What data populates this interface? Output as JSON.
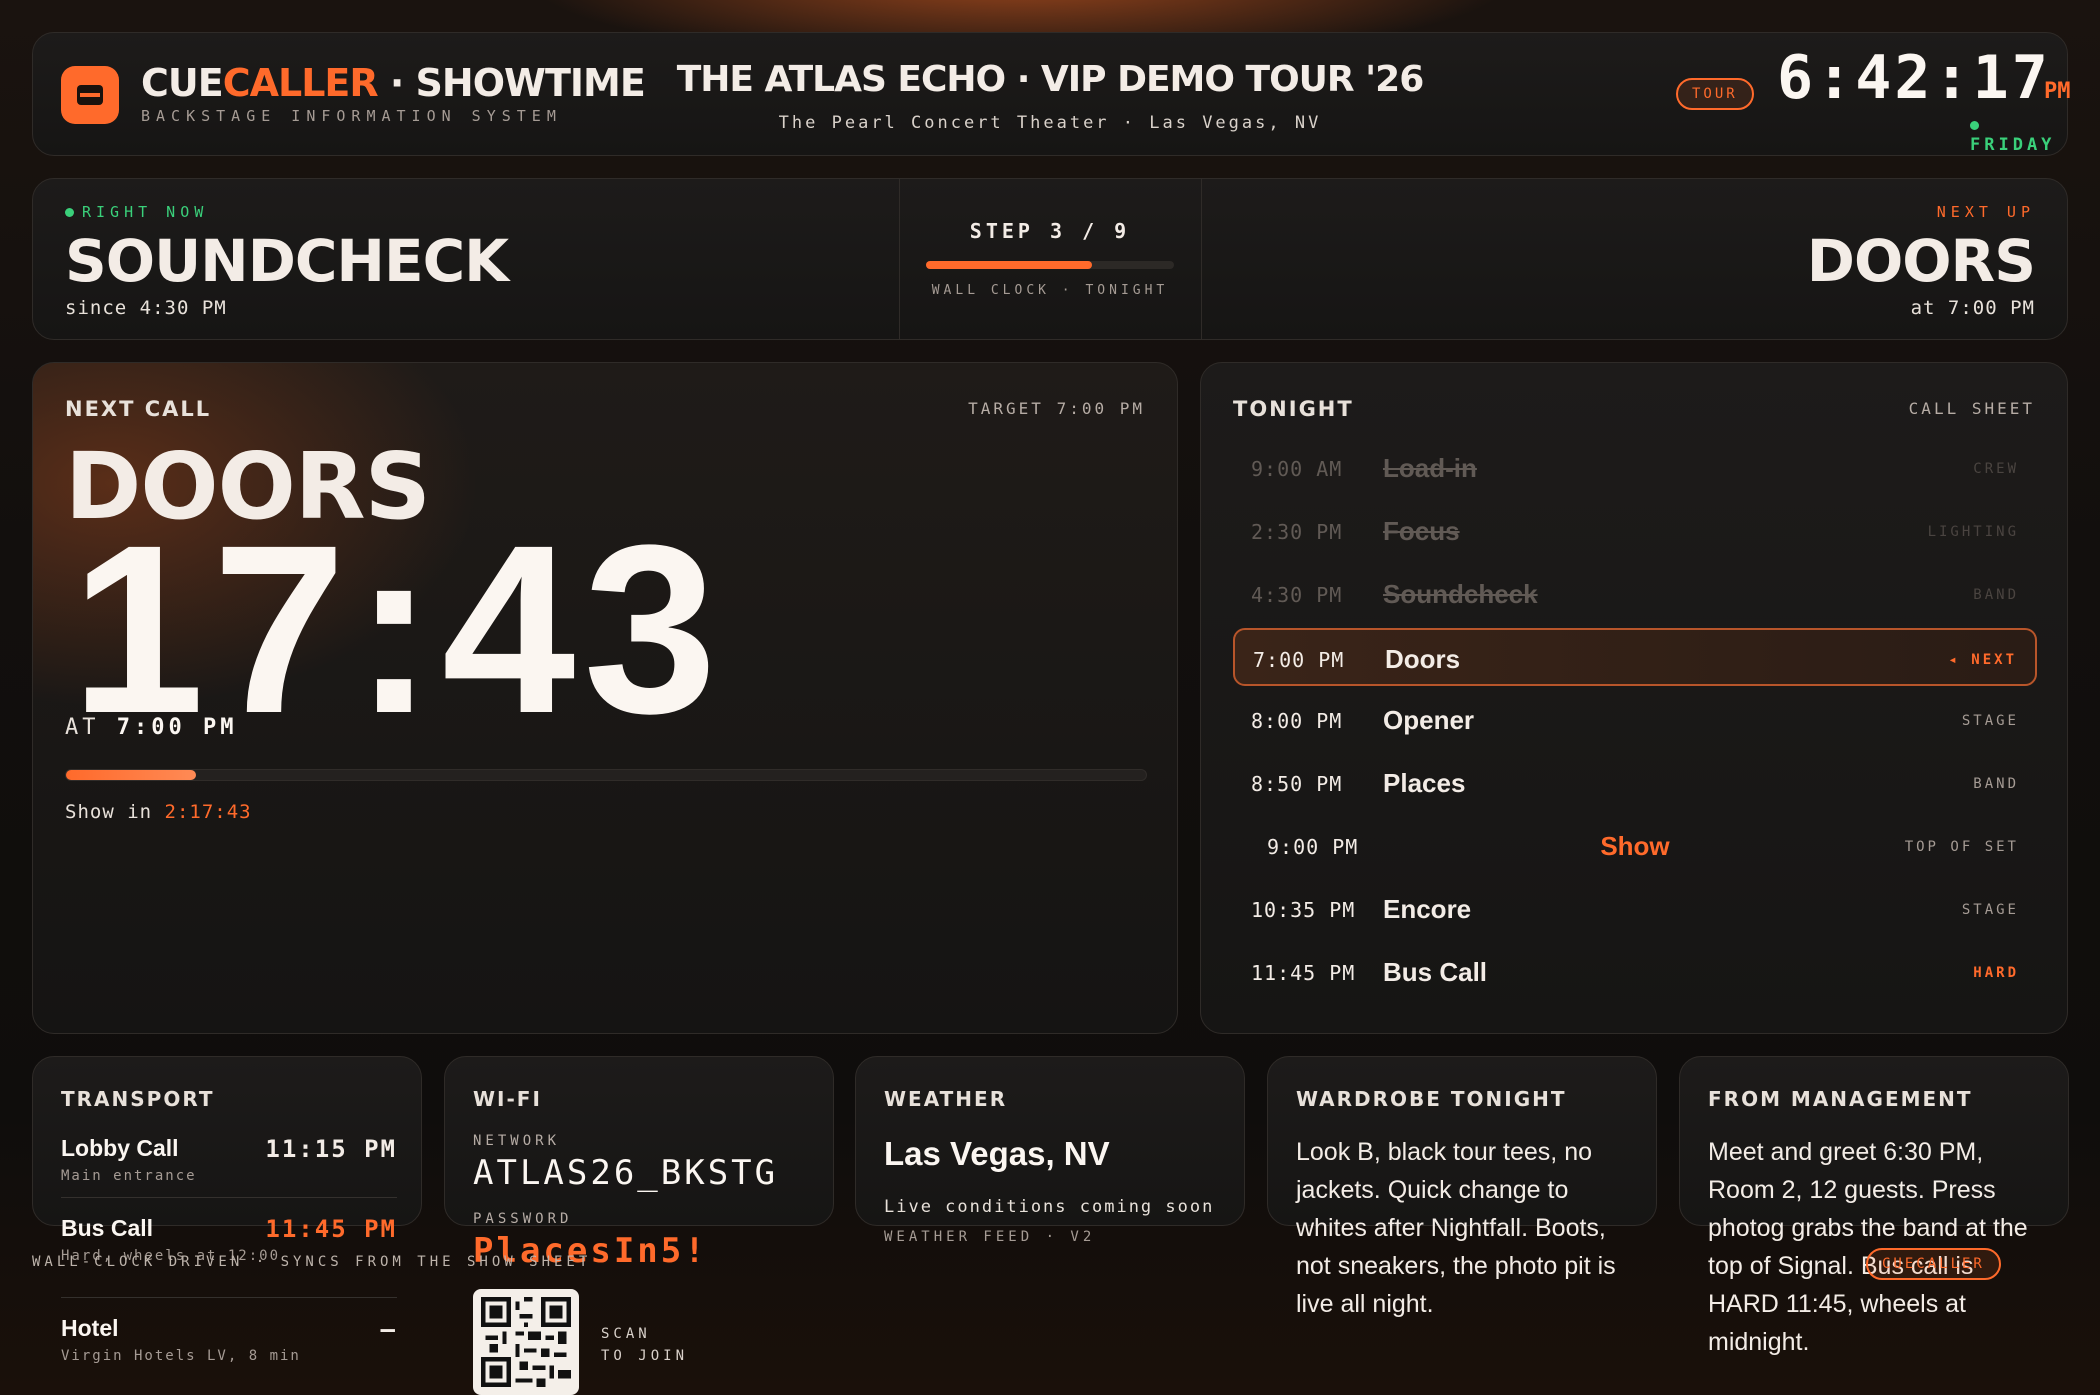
{
  "header": {
    "brand_cue": "CUE",
    "brand_caller": "CALLER",
    "brand_rest": " · SHOWTIME",
    "brand_sub": "BACKSTAGE INFORMATION SYSTEM",
    "tour_title": "THE ATLAS ECHO · VIP DEMO TOUR '26",
    "venue": "The Pearl Concert Theater · Las Vegas, NV",
    "badge": "TOUR",
    "clock": "6:42:17",
    "ampm": "PM",
    "day": "FRIDAY"
  },
  "now": {
    "label": "RIGHT NOW",
    "title": "SOUNDCHECK",
    "since": "since 4:30 PM",
    "step": "STEP 3 / 9",
    "step_progress": 0.67,
    "step_foot": "WALL CLOCK · TONIGHT",
    "next_label": "NEXT UP",
    "next_title": "DOORS",
    "next_at": "at 7:00 PM"
  },
  "next_call": {
    "label": "NEXT CALL",
    "target": "TARGET 7:00 PM",
    "title": "DOORS",
    "countdown": "17:43",
    "at_label": "AT",
    "at_time": "7:00 PM",
    "progress": 0.12,
    "show_label": "Show in",
    "show_in": "2:17:43"
  },
  "tonight": {
    "label": "TONIGHT",
    "sheet": "CALL SHEET",
    "rows": [
      {
        "time": "9:00 AM",
        "name": "Load-in",
        "tag": "CREW"
      },
      {
        "time": "2:30 PM",
        "name": "Focus",
        "tag": "LIGHTING"
      },
      {
        "time": "4:30 PM",
        "name": "Soundcheck",
        "tag": "BAND"
      },
      {
        "time": "7:00 PM",
        "name": "Doors",
        "tag": "◂ NEXT"
      },
      {
        "time": "8:00 PM",
        "name": "Opener",
        "tag": "STAGE"
      },
      {
        "time": "8:50 PM",
        "name": "Places",
        "tag": "BAND"
      },
      {
        "time": "9:00 PM",
        "name": "Show",
        "tag": "TOP OF SET"
      },
      {
        "time": "10:35 PM",
        "name": "Encore",
        "tag": "STAGE"
      },
      {
        "time": "11:45 PM",
        "name": "Bus Call",
        "tag": "HARD"
      }
    ]
  },
  "transport": {
    "label": "TRANSPORT",
    "items": [
      {
        "name": "Lobby Call",
        "time": "11:15 PM",
        "sub": "Main entrance"
      },
      {
        "name": "Bus Call",
        "time": "11:45 PM",
        "sub": "Hard, wheels at 12:00"
      },
      {
        "name": "Hotel",
        "time": "—",
        "sub": "Virgin Hotels LV, 8 min"
      }
    ]
  },
  "wifi": {
    "label": "WI-FI",
    "network_label": "NETWORK",
    "network": "ATLAS26_BKSTG",
    "password_label": "PASSWORD",
    "password": "PlacesIn5!",
    "scan_1": "SCAN",
    "scan_2": "TO JOIN"
  },
  "weather": {
    "label": "WEATHER",
    "city": "Las Vegas, NV",
    "status": "Live conditions coming soon",
    "feed": "WEATHER FEED · V2"
  },
  "wardrobe": {
    "label": "WARDROBE TONIGHT",
    "text": "Look B, black tour tees, no jackets. Quick change to whites after Nightfall. Boots, not sneakers, the photo pit is live all night."
  },
  "management": {
    "label": "FROM MANAGEMENT",
    "text": "Meet and greet 6:30 PM, Room 2, 12 guests. Press photog grabs the band at the top of Signal. Bus call is HARD 11:45, wheels at midnight."
  },
  "footer": {
    "note": "WALL-CLOCK DRIVEN · SYNCS FROM THE SHOW SHEET",
    "badge": "CUECALLER"
  },
  "colors": {
    "accent": "#ff6a2b",
    "live": "#3ad07a",
    "panel": "#1a1817"
  }
}
